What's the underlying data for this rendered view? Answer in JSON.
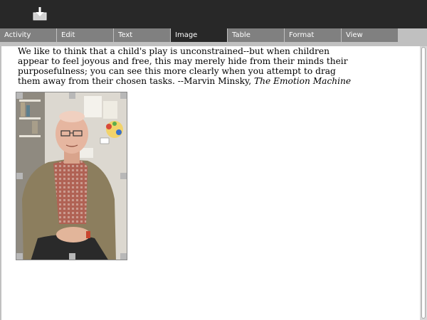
{
  "toolbar": {
    "download_icon": "download-icon"
  },
  "tabs": [
    {
      "label": "Activity",
      "active": false
    },
    {
      "label": "Edit",
      "active": false
    },
    {
      "label": "Text",
      "active": false
    },
    {
      "label": "Image",
      "active": true
    },
    {
      "label": "Table",
      "active": false
    },
    {
      "label": "Format",
      "active": false
    },
    {
      "label": "View",
      "active": false
    }
  ],
  "document": {
    "quote_text": "We like to think that a child's play is unconstrained--but when children appear to feel joyous and free, this may merely hide from their minds their purposefulness; you can see this more clearly when you attempt to drag them away from their chosen tasks. --Marvin Minsky, ",
    "quote_source": "The Emotion Machine",
    "image_icon": "photo-portrait"
  },
  "colors": {
    "toolbar_bg": "#282828",
    "tab_bg": "#808080",
    "tab_active_bg": "#282828",
    "canvas_bg": "#ffffff"
  }
}
